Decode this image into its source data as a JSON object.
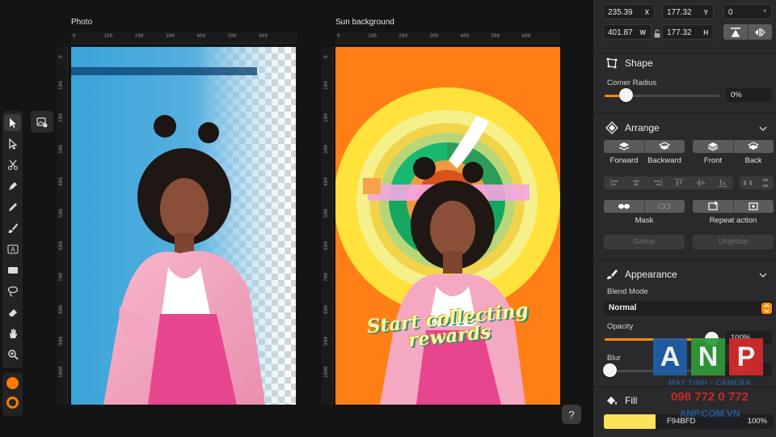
{
  "canvas": {
    "documents": [
      {
        "title": "Photo"
      },
      {
        "title": "Sun background",
        "headline_line1": "Start collecting",
        "headline_line2": "rewards"
      }
    ],
    "ruler_top_ticks": [
      "0",
      "100",
      "200",
      "300",
      "400",
      "500",
      "600"
    ],
    "ruler_left_ticks": [
      "0",
      "100",
      "200",
      "300",
      "400",
      "500",
      "600",
      "700",
      "800",
      "900",
      "1000"
    ],
    "help_label": "?"
  },
  "toolbar": {
    "tools": [
      {
        "icon": "select-arrow-icon",
        "active": true
      },
      {
        "icon": "direct-select-icon"
      },
      {
        "icon": "scissors-icon"
      },
      {
        "icon": "pen-icon"
      },
      {
        "icon": "pencil-icon"
      },
      {
        "icon": "brush-icon"
      },
      {
        "icon": "text-tool-icon",
        "label": "A"
      },
      {
        "icon": "rectangle-icon"
      },
      {
        "icon": "lasso-icon"
      },
      {
        "icon": "eraser-icon"
      },
      {
        "icon": "hand-icon"
      },
      {
        "icon": "zoom-icon"
      }
    ],
    "fill_color": "#ff7a00",
    "stroke_color": "#ff7a00"
  },
  "inspector": {
    "geometry": {
      "x": {
        "value": "235.39",
        "unit": "X"
      },
      "y": {
        "value": "177.32",
        "unit": "Y"
      },
      "rotation": {
        "value": "0",
        "unit": "°"
      },
      "w": {
        "value": "401.87",
        "unit": "W"
      },
      "h": {
        "value": "177.32",
        "unit": "H"
      }
    },
    "shape": {
      "title": "Shape",
      "corner_radius_label": "Corner Radius",
      "corner_radius_value": "0%",
      "corner_radius_fraction": 0.0
    },
    "arrange": {
      "title": "Arrange",
      "order_labels": [
        "Forward",
        "Backward",
        "Front",
        "Back"
      ],
      "mask_label": "Mask",
      "repeat_label": "Repeat action",
      "group_label": "Group",
      "ungroup_label": "Ungroup"
    },
    "appearance": {
      "title": "Appearance",
      "blend_mode_label": "Blend Mode",
      "blend_mode_value": "Normal",
      "opacity_label": "Opacity",
      "opacity_value": "100%",
      "opacity_fraction": 1.0,
      "blur_label": "Blur",
      "blur_value": "100%",
      "blur_fraction": 0.0
    },
    "fill": {
      "title": "Fill",
      "hex": "F94BFD",
      "percent": "100%",
      "color": "#fbe35a"
    }
  },
  "watermark": {
    "letters": [
      "A",
      "N",
      "P"
    ],
    "line1": "MAY TINH - CAMERA",
    "phone": "098 772 0 772",
    "site": "ANP.COM.VN"
  },
  "colors": {
    "accent": "#ff8a00",
    "sun_background": "#ff7e16"
  }
}
